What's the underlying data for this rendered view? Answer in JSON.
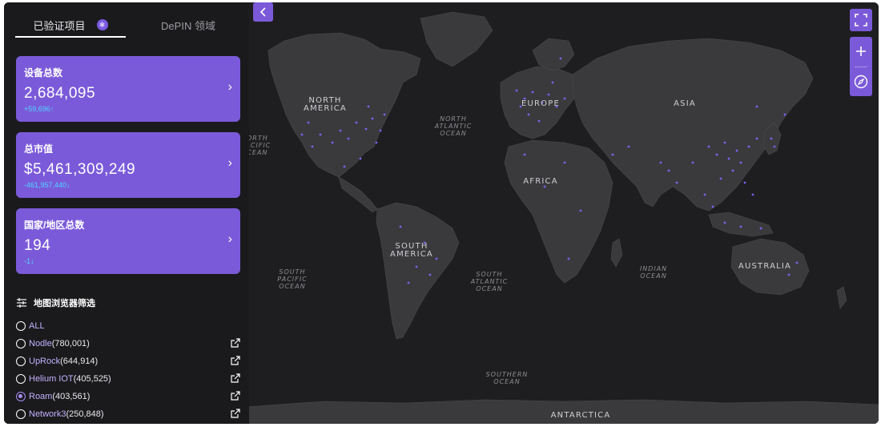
{
  "tabs": [
    {
      "label": "已验证项目",
      "badge": "❄"
    },
    {
      "label": "DePIN 领域"
    }
  ],
  "cards": [
    {
      "title": "设备总数",
      "value": "2,684,095",
      "delta": "+59,696↑"
    },
    {
      "title": "总市值",
      "value": "$5,461,309,249",
      "delta": "-461,957,440↓"
    },
    {
      "title": "国家/地区总数",
      "value": "194",
      "delta": "-1↓"
    }
  ],
  "filter": {
    "title": "地图浏览器筛选",
    "options": [
      {
        "name": "ALL",
        "count": "",
        "selected": false,
        "external": false
      },
      {
        "name": "Nodle",
        "count": "(780,001)",
        "selected": false,
        "external": true
      },
      {
        "name": "UpRock",
        "count": "(644,914)",
        "selected": false,
        "external": true
      },
      {
        "name": "Helium IOT",
        "count": "(405,525)",
        "selected": false,
        "external": true
      },
      {
        "name": "Roam",
        "count": "(403,561)",
        "selected": true,
        "external": true
      },
      {
        "name": "Network3",
        "count": "(250,848)",
        "selected": false,
        "external": true
      }
    ]
  },
  "map": {
    "continents": [
      "NORTH AMERICA",
      "EUROPE",
      "ASIA",
      "AFRICA",
      "SOUTH AMERICA",
      "AUSTRALIA",
      "ANTARCTICA"
    ],
    "oceans": [
      "NORTH ATLANTIC OCEAN",
      "SOUTH PACIFIC OCEAN",
      "SOUTH ATLANTIC OCEAN",
      "INDIAN OCEAN",
      "SOUTHERN OCEAN",
      "NORTH PACIFIC OCEAN"
    ]
  },
  "colors": {
    "accent": "#7b5ad9",
    "delta": "#4fd6ff",
    "map_bg": "#1e1e20",
    "land": "#3a3a3d",
    "dots": "#8a63ff"
  },
  "icons": {
    "collapse": "chevron-left-icon",
    "fullscreen": "fullscreen-icon",
    "zoom_in": "plus-icon",
    "zoom_out": "minus-icon",
    "compass": "compass-icon"
  }
}
